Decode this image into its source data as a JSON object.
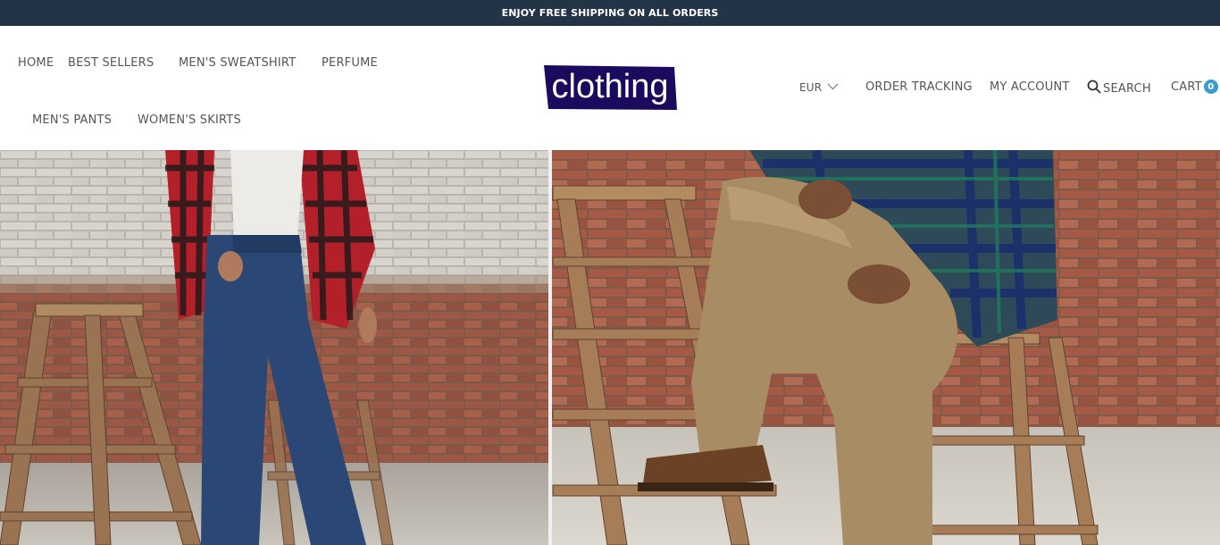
{
  "announcement": "ENJOY FREE SHIPPING ON ALL ORDERS",
  "nav": {
    "home": "HOME",
    "best_sellers": "BEST SELLERS",
    "mens_sweatshirt": "MEN'S SWEATSHIRT",
    "perfume": "PERFUME",
    "mens_pants": "MEN'S PANTS",
    "womens_skirts": "WOMEN'S SKIRTS"
  },
  "logo": {
    "text": "clothing",
    "bg_color": "#1b0a5e",
    "text_color": "#ffffff"
  },
  "header_right": {
    "currency": "EUR",
    "order_tracking": "ORDER TRACKING",
    "my_account": "MY ACCOUNT",
    "search": "SEARCH",
    "cart": "CART",
    "cart_count": "0"
  },
  "colors": {
    "announcement_bg": "#243447",
    "badge": "#3a9bd1",
    "text": "#555555"
  },
  "hero": {
    "left_panel": "man in red plaid shirt and blue jeans beside wooden ladder",
    "right_panel": "man in green plaid shirt and tan pants sitting on wooden ladder"
  }
}
